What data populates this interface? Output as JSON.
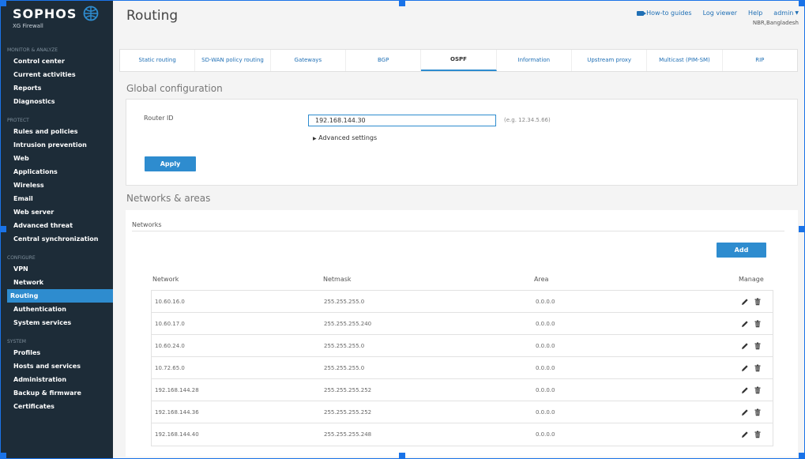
{
  "brand": {
    "name": "SOPHOS",
    "product": "XG Firewall"
  },
  "sidebar": {
    "sections": [
      {
        "head": "MONITOR & ANALYZE",
        "items": [
          "Control center",
          "Current activities",
          "Reports",
          "Diagnostics"
        ]
      },
      {
        "head": "PROTECT",
        "items": [
          "Rules and policies",
          "Intrusion prevention",
          "Web",
          "Applications",
          "Wireless",
          "Email",
          "Web server",
          "Advanced threat",
          "Central synchronization"
        ]
      },
      {
        "head": "CONFIGURE",
        "items": [
          "VPN",
          "Network",
          "Routing",
          "Authentication",
          "System services"
        ]
      },
      {
        "head": "SYSTEM",
        "items": [
          "Profiles",
          "Hosts and services",
          "Administration",
          "Backup & firmware",
          "Certificates"
        ]
      }
    ],
    "active": "Routing"
  },
  "header": {
    "title": "Routing",
    "links": {
      "howto": "How-to guides",
      "logviewer": "Log viewer",
      "help": "Help",
      "user": "admin"
    },
    "user_sub": "NBR,Bangladesh"
  },
  "tabs": [
    "Static routing",
    "SD-WAN policy routing",
    "Gateways",
    "BGP",
    "OSPF",
    "Information",
    "Upstream proxy",
    "Multicast (PIM-SM)",
    "RIP"
  ],
  "active_tab": "OSPF",
  "global": {
    "title": "Global configuration",
    "router_id_label": "Router ID",
    "router_id_value": "192.168.144.30",
    "router_id_hint": "(e.g. 12.34.5.66)",
    "advanced": "Advanced settings",
    "apply": "Apply"
  },
  "networks": {
    "title": "Networks & areas",
    "subtitle": "Networks",
    "add": "Add",
    "columns": [
      "Network",
      "Netmask",
      "Area",
      "Manage"
    ],
    "rows": [
      [
        "10.60.16.0",
        "255.255.255.0",
        "0.0.0.0"
      ],
      [
        "10.60.17.0",
        "255.255.255.240",
        "0.0.0.0"
      ],
      [
        "10.60.24.0",
        "255.255.255.0",
        "0.0.0.0"
      ],
      [
        "10.72.65.0",
        "255.255.255.0",
        "0.0.0.0"
      ],
      [
        "192.168.144.28",
        "255.255.255.252",
        "0.0.0.0"
      ],
      [
        "192.168.144.36",
        "255.255.255.252",
        "0.0.0.0"
      ],
      [
        "192.168.144.40",
        "255.255.255.248",
        "0.0.0.0"
      ]
    ]
  },
  "colors": {
    "sidebar": "#1d2c38",
    "accent": "#2e8ccf",
    "link": "#1f6fb5"
  }
}
